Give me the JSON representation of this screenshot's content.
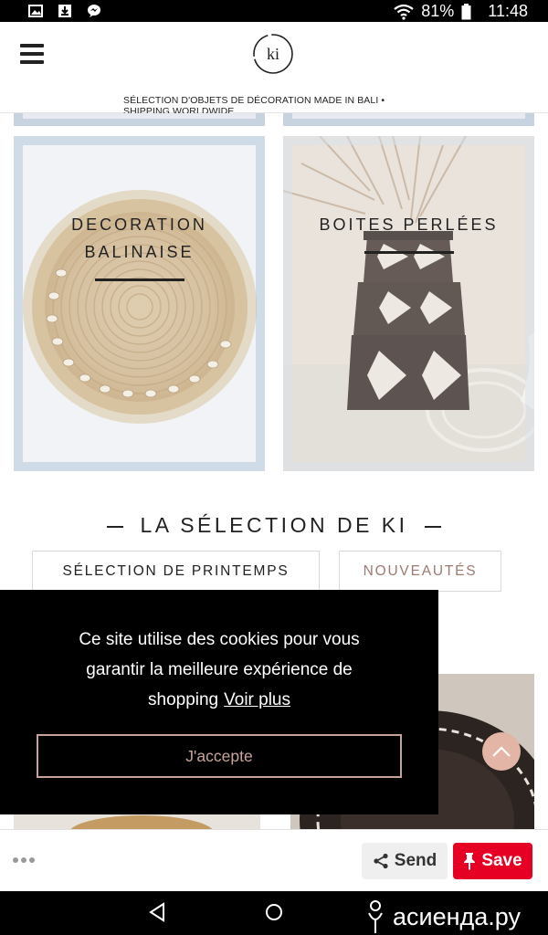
{
  "status_bar": {
    "battery": "81%",
    "time": "11:48",
    "icons": [
      "image-icon",
      "download-icon",
      "messenger-icon",
      "wifi-icon",
      "battery-icon"
    ]
  },
  "header": {
    "logo_text": "ki",
    "tagline": "SÉLECTION D'OBJETS DE DÉCORATION MADE IN BALI • SHIPPING WORLDWIDE"
  },
  "categories": [
    {
      "title_line1": "DECORATION",
      "title_line2": "BALINAISE"
    },
    {
      "title_line1": "BOITES PERLÉES"
    }
  ],
  "selection": {
    "title": "LA SÉLECTION DE KI",
    "tabs": [
      {
        "label": "SÉLECTION DE PRINTEMPS",
        "color": "#222222"
      },
      {
        "label": "NOUVEAUTÉS",
        "color": "#9c7a73"
      }
    ]
  },
  "cookie_banner": {
    "message_line1": "Ce site utilise des cookies pour vous",
    "message_line2": "garantir la meilleure expérience de",
    "message_line3": "shopping",
    "link_label": "Voir plus",
    "accept_label": "J'accepte"
  },
  "share_bar": {
    "send_label": "Send",
    "save_label": "Save",
    "save_color": "#e60023"
  },
  "watermark": "асиенда.ру"
}
